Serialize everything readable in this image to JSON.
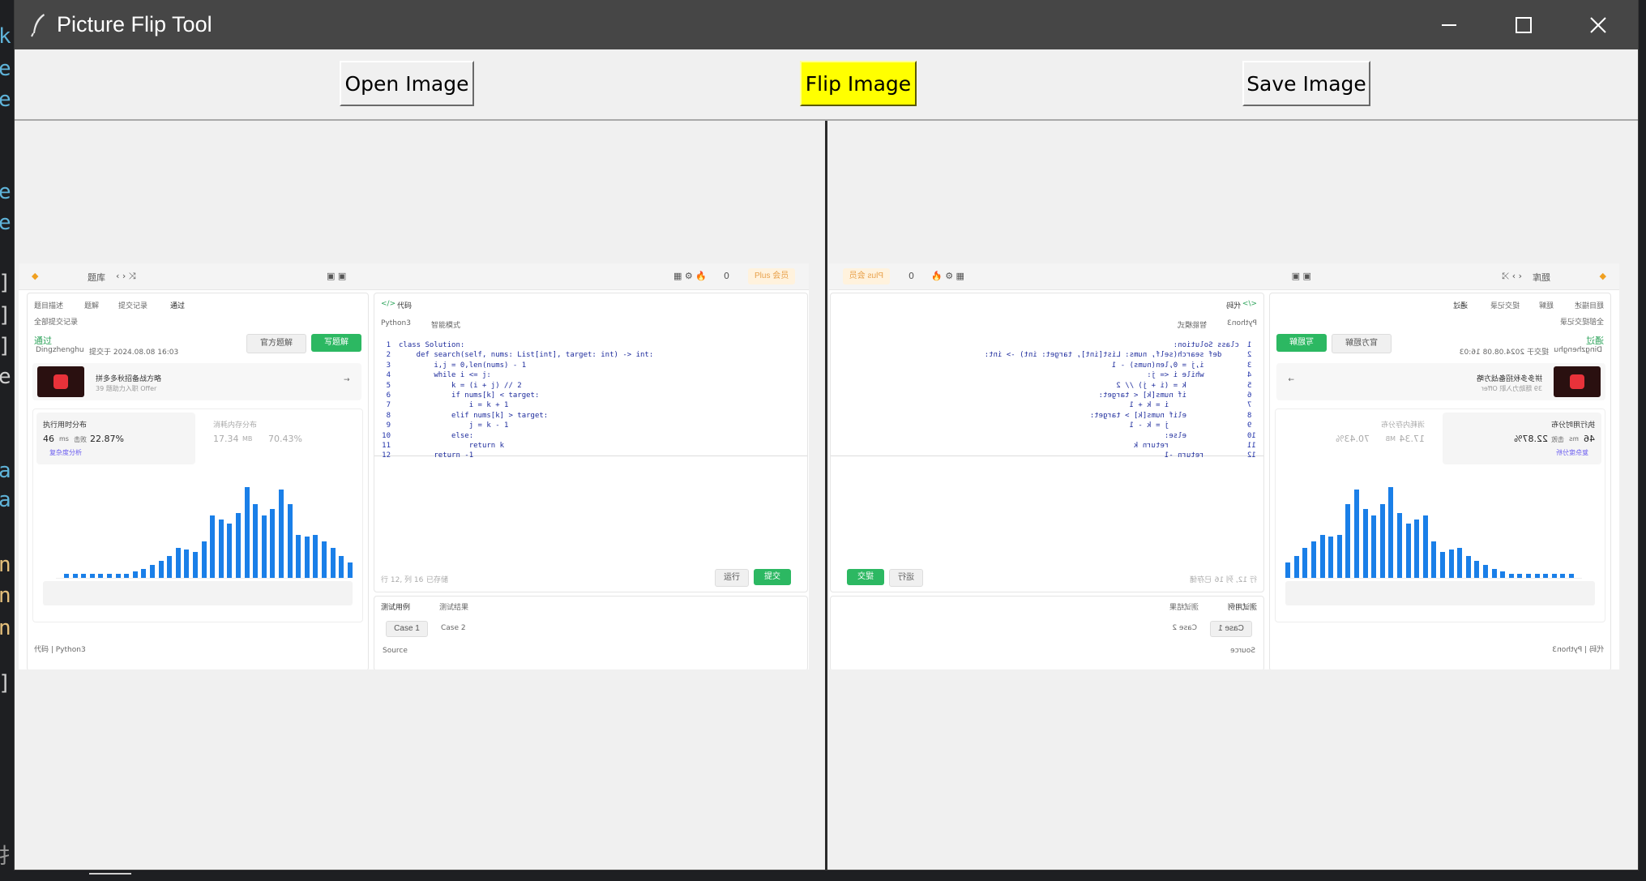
{
  "window": {
    "title": "Picture Flip Tool",
    "controls": {
      "minimize": "minimize-icon",
      "maximize": "maximize-icon",
      "close": "close-icon"
    },
    "icon": "feather-icon"
  },
  "toolbar": {
    "open_label": "Open Image",
    "flip_label": "Flip Image",
    "save_label": "Save Image",
    "flip_color": "#ffff00"
  },
  "preview": {
    "topbar": {
      "problems": "题库",
      "plus": "Plus 会员",
      "count": "0"
    },
    "tabs": [
      "题目描述",
      "题解",
      "提交记录",
      "通过"
    ],
    "back": "全部提交记录",
    "status": "通过",
    "user": "Dingzhenghu",
    "submitted": "提交于 2024.08.08 16:03",
    "official_solution": "官方题解",
    "write_solution": "写题解",
    "promo_title": "拼多多秋招备战方略",
    "promo_sub": "39 题助力入职 Offer",
    "runtime_label": "执行用时分布",
    "runtime_value": "46",
    "runtime_unit": "ms",
    "runtime_beat": "击败",
    "runtime_pct": "22.87%",
    "memory_label": "消耗内存分布",
    "memory_value": "17.34",
    "memory_unit": "MB",
    "memory_pct": "70.43%",
    "analysis": "复杂度分析",
    "code_label": "代码",
    "lang": "Python3",
    "smart": "智能模式",
    "code_footer_label": "代码 | Python3",
    "position": "行 12, 列 16",
    "saved": "已存储",
    "run": "运行",
    "submit": "提交",
    "testcase": "测试用例",
    "testresult": "测试结果",
    "case1": "Case 1",
    "case2": "Case 2",
    "source": "Source",
    "code_lines": [
      "class Solution:",
      "    def search(self, nums: List[int], target: int) -> int:",
      "        i,j = 0,len(nums) - 1",
      "        while i <= j:",
      "            k = (i + j) // 2",
      "            if nums[k] < target:",
      "                i = k + 1",
      "            elif nums[k] > target:",
      "                j = k - 1",
      "            else:",
      "                return k",
      "        return -1"
    ],
    "histogram": [
      2,
      2,
      2,
      2,
      2,
      2,
      2,
      2,
      3,
      4,
      6,
      8,
      10,
      14,
      13,
      12,
      17,
      29,
      27,
      25,
      30,
      42,
      34,
      29,
      32,
      41,
      34,
      20,
      19,
      20,
      17,
      14,
      10,
      7
    ]
  }
}
